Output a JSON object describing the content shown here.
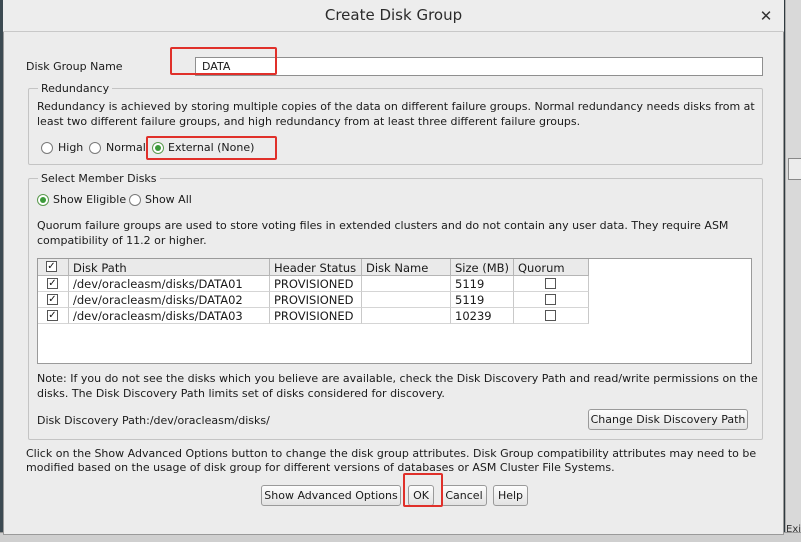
{
  "dialog": {
    "title": "Create Disk Group"
  },
  "disk_group_name": {
    "label": "Disk Group Name",
    "value": "DATA"
  },
  "redundancy": {
    "legend": "Redundancy",
    "description_line1": "Redundancy is achieved by storing multiple copies of the data on different failure groups. Normal redundancy needs disks from at",
    "description_line2": "least two different failure groups, and high redundancy from at least three different failure groups.",
    "options": [
      "High",
      "Normal",
      "External (None)"
    ],
    "selected": "External (None)"
  },
  "member_disks": {
    "legend": "Select Member Disks",
    "filters": [
      "Show Eligible",
      "Show All"
    ],
    "selected_filter": "Show Eligible",
    "quorum_line1": "Quorum failure groups are used to store voting files in extended clusters and do not contain any user data. They require ASM",
    "quorum_line2": "compatibility of 11.2 or higher.",
    "columns": [
      "",
      "Disk Path",
      "Header Status",
      "Disk Name",
      "Size (MB)",
      "Quorum"
    ],
    "rows": [
      {
        "selected": true,
        "path": "/dev/oracleasm/disks/DATA01",
        "status": "PROVISIONED",
        "name": "",
        "size": "5119",
        "quorum": false
      },
      {
        "selected": true,
        "path": "/dev/oracleasm/disks/DATA02",
        "status": "PROVISIONED",
        "name": "",
        "size": "5119",
        "quorum": false
      },
      {
        "selected": true,
        "path": "/dev/oracleasm/disks/DATA03",
        "status": "PROVISIONED",
        "name": "",
        "size": "10239",
        "quorum": false
      }
    ],
    "note_line1": "Note: If you do not see the disks which you believe are available, check the Disk Discovery Path and read/write permissions on the",
    "note_line2": "disks. The Disk Discovery Path limits set of disks considered for discovery.",
    "discovery_path": "Disk Discovery Path:/dev/oracleasm/disks/",
    "change_path_button": "Change Disk Discovery Path"
  },
  "footer": {
    "info_line1": "Click on the Show Advanced Options button to change the disk group attributes. Disk Group compatibility attributes may need to be",
    "info_line2": "modified based on the usage of disk group for different versions of databases or ASM Cluster File Systems.",
    "buttons": {
      "advanced": "Show Advanced Options",
      "ok": "OK",
      "cancel": "Cancel",
      "help": "Help"
    }
  },
  "background": {
    "corner_text": "Exit"
  },
  "colors": {
    "highlight": "#e0302a",
    "radio_selected": "#3c9a3a"
  },
  "icons": {
    "close": "close-icon",
    "check": "checkmark-icon"
  }
}
